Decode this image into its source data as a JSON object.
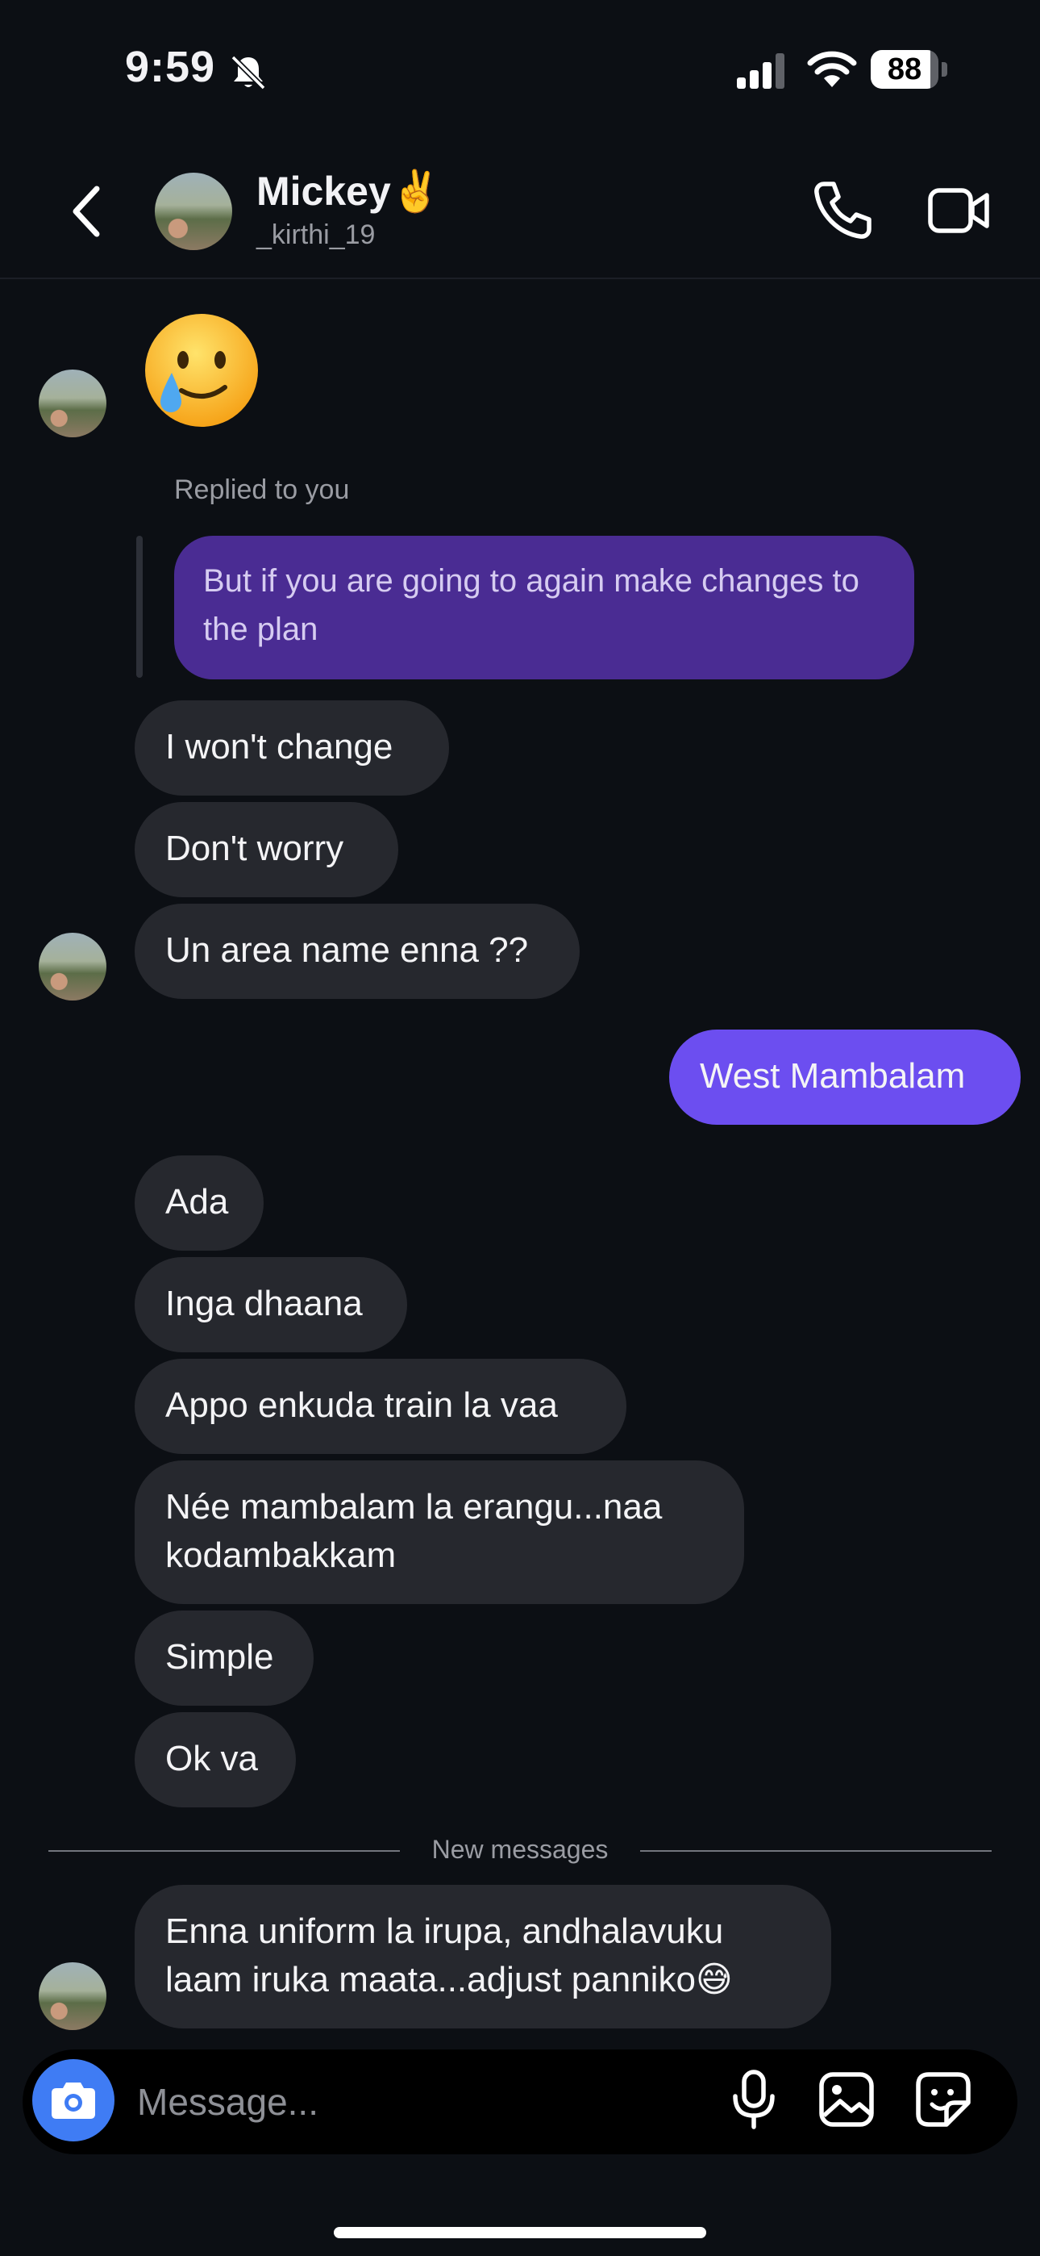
{
  "status_bar": {
    "time": "9:59",
    "battery": "88",
    "battery_fraction": 0.88
  },
  "header": {
    "name": "Mickey✌️",
    "username": "_kirthi_19"
  },
  "icons": {
    "back": "chevron-left-icon",
    "call": "phone-icon",
    "video": "video-camera-icon",
    "camera": "camera-icon",
    "mic": "microphone-icon",
    "gallery": "image-icon",
    "sticker": "sticker-icon",
    "bell": "bell-slash-icon",
    "signal": "cellular-signal-icon",
    "wifi": "wifi-icon"
  },
  "messages": {
    "emoji": "🥲",
    "replied_label": "Replied to you",
    "replied_to": "But if you are going to again make changes to the plan",
    "m1": "I won't change",
    "m2": "Don't worry",
    "m3": "Un area name enna ??",
    "sent1": "West Mambalam",
    "m4": "Ada",
    "m5": "Inga dhaana",
    "m6": "Appo enkuda train la vaa",
    "m7": "Née mambalam la erangu...naa kodambakkam",
    "m8": "Simple",
    "m9": "Ok va",
    "divider": "New messages",
    "m10": "Enna uniform la irupa, andhalavuku laam iruka maata...adjust panniko😅"
  },
  "composer": {
    "placeholder": "Message..."
  },
  "colors": {
    "background": "#0c0f14",
    "incoming_bubble": "#26282e",
    "outgoing_bubble": "#6c4ef0",
    "reply_bubble": "#4a2c93",
    "camera_button": "#3f7cf4"
  }
}
